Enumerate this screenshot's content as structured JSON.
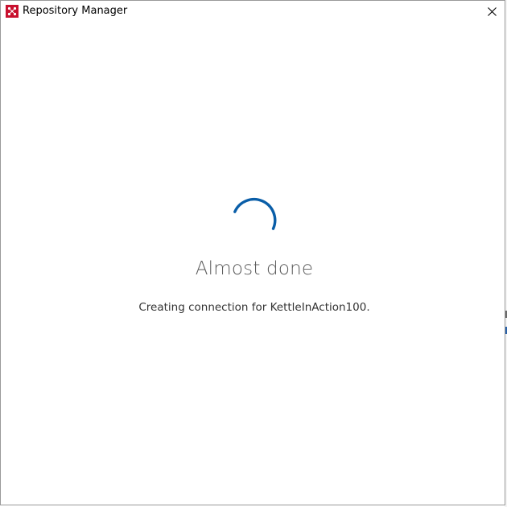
{
  "window": {
    "title": "Repository Manager",
    "app_icon": "pentaho-spoon-icon",
    "close_icon": "close-icon"
  },
  "loading": {
    "spinner_icon": "loading-spinner-icon",
    "headline": "Almost done",
    "status": "Creating connection for KettleInAction100."
  },
  "colors": {
    "spinner": "#0a5ea8",
    "headline": "#5a5a5a",
    "status": "#333333",
    "app_icon_bg": "#c8102e"
  }
}
